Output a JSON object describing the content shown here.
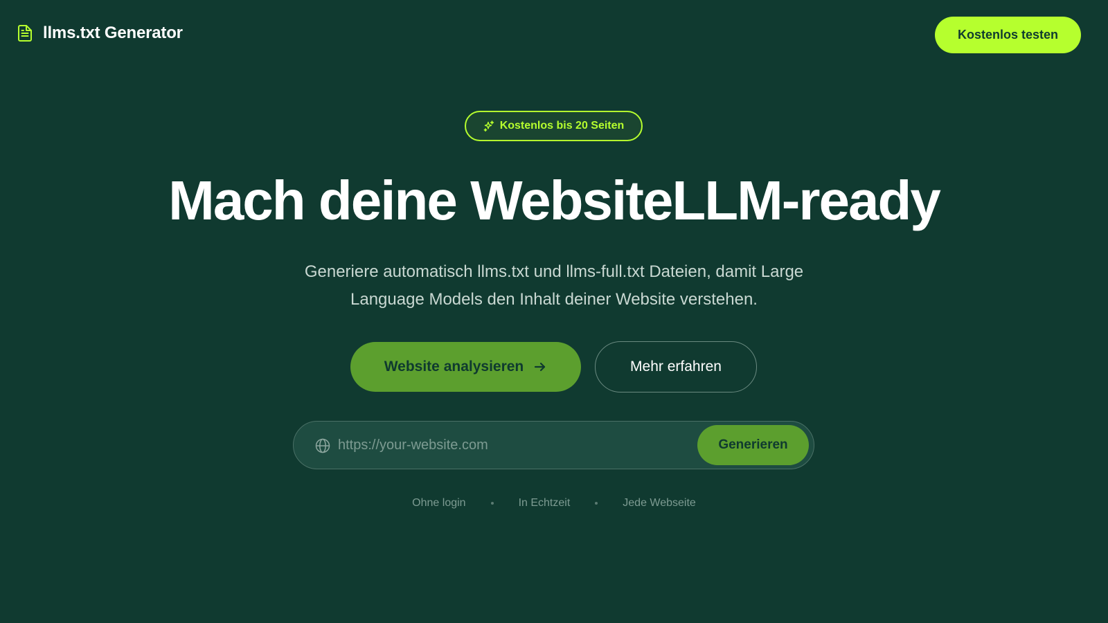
{
  "header": {
    "brand_icon": "document-icon",
    "brand_title": "llms.txt Generator",
    "cta_label": "Kostenlos testen"
  },
  "colors": {
    "background": "#103a30",
    "accent": "#b6ff2e",
    "primary_button": "#5c9f2e"
  },
  "hero": {
    "badge_icon": "sparkles-icon",
    "badge_text": "Kostenlos bis 20 Seiten",
    "headline": "Mach deine WebsiteLLM-ready",
    "subtitle_line1": "Generiere automatisch llms.txt und llms-full.txt Dateien, damit Large",
    "subtitle_line2": "Language Models den Inhalt deiner Website verstehen.",
    "primary_button_label": "Website analysieren",
    "primary_button_icon": "arrow-right-icon",
    "secondary_button_label": "Mehr erfahren"
  },
  "url_form": {
    "icon": "globe-icon",
    "placeholder": "https://your-website.com",
    "value": "",
    "submit_label": "Generieren"
  },
  "features": [
    "Ohne login",
    "In Echtzeit",
    "Jede Webseite"
  ]
}
